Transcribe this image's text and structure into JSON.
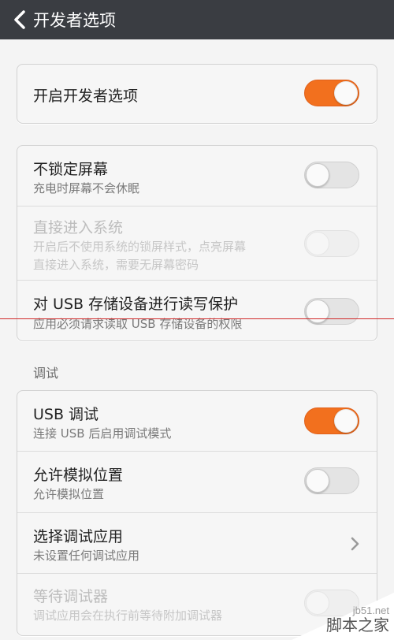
{
  "header": {
    "title": "开发者选项"
  },
  "card1": {
    "rows": [
      {
        "title": "开启开发者选项",
        "state": "on"
      }
    ]
  },
  "card2": {
    "rows": [
      {
        "title": "不锁定屏幕",
        "subtitle": "充电时屏幕不会休眠",
        "state": "off"
      },
      {
        "title": "直接进入系统",
        "subtitle1": "开启后不使用系统的锁屏样式，点亮屏幕",
        "subtitle2": "直接进入系统，需要无屏幕密码",
        "state": "disabled"
      },
      {
        "title": "对 USB 存储设备进行读写保护",
        "subtitle": "应用必须请求读取 USB 存储设备的权限",
        "state": "off"
      }
    ]
  },
  "section": {
    "label": "调试"
  },
  "card3": {
    "rows": [
      {
        "title": "USB 调试",
        "subtitle": "连接 USB 后启用调试模式",
        "state": "on"
      },
      {
        "title": "允许模拟位置",
        "subtitle": "允许模拟位置",
        "state": "off"
      },
      {
        "title": "选择调试应用",
        "subtitle": "未设置任何调试应用",
        "icon": "chevron-right-icon"
      },
      {
        "title": "等待调试器",
        "subtitle": "调试应用会在执行前等待附加调试器",
        "state": "disabled"
      }
    ]
  },
  "watermark": {
    "site": "jb51.net",
    "name": "脚本之家"
  },
  "colors": {
    "accent": "#f2701e",
    "header_bg": "#3a3d42"
  }
}
